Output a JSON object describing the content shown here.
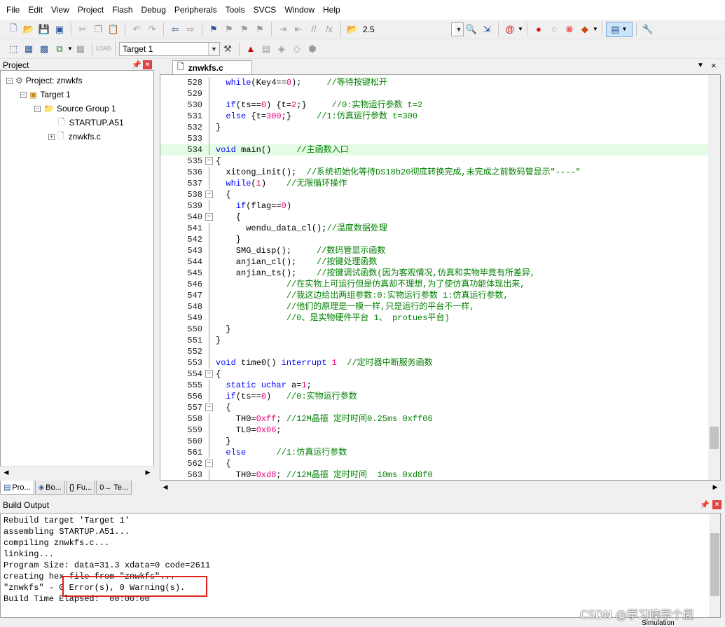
{
  "menu": [
    "File",
    "Edit",
    "View",
    "Project",
    "Flash",
    "Debug",
    "Peripherals",
    "Tools",
    "SVCS",
    "Window",
    "Help"
  ],
  "toolbar": {
    "opt_value": "2.5",
    "target_value": "Target 1"
  },
  "project_panel": {
    "title": "Project",
    "tree": {
      "project": "Project: znwkfs",
      "target": "Target 1",
      "group": "Source Group 1",
      "files": [
        "STARTUP.A51",
        "znwkfs.c"
      ]
    },
    "tabs": [
      "Pro...",
      "Bo...",
      "{} Fu...",
      "0→ Te..."
    ]
  },
  "editor": {
    "tab": "znwkfs.c",
    "lines": [
      {
        "n": "528",
        "code": "  while(Key4==0);     //等待按键松开"
      },
      {
        "n": "529",
        "code": ""
      },
      {
        "n": "530",
        "code": "  if(ts==0) {t=2;}     //0:实物运行参数 t=2"
      },
      {
        "n": "531",
        "code": "  else {t=300;}     //1:仿真运行参数 t=300"
      },
      {
        "n": "532",
        "code": "}"
      },
      {
        "n": "533",
        "code": ""
      },
      {
        "n": "534",
        "code": "void main()     //主函数入口"
      },
      {
        "n": "535",
        "code": "{"
      },
      {
        "n": "536",
        "code": "  xitong_init();  //系统初始化等待DS18b20彻底转换完成,未完成之前数码管显示\"----\""
      },
      {
        "n": "537",
        "code": "  while(1)    //无限循环操作"
      },
      {
        "n": "538",
        "code": "  {"
      },
      {
        "n": "539",
        "code": "    if(flag==0)"
      },
      {
        "n": "540",
        "code": "    {"
      },
      {
        "n": "541",
        "code": "      wendu_data_cl();//温度数据处理"
      },
      {
        "n": "542",
        "code": "    }"
      },
      {
        "n": "543",
        "code": "    SMG_disp();     //数码管显示函数"
      },
      {
        "n": "544",
        "code": "    anjian_cl();    //按键处理函数"
      },
      {
        "n": "545",
        "code": "    anjian_ts();    //按键调试函数(因为客观情况,仿真和实物毕竟有所差异,"
      },
      {
        "n": "546",
        "code": "              //在实物上可运行但是仿真却不理想,为了使仿真功能体现出来,"
      },
      {
        "n": "547",
        "code": "              //我这边给出两组参数:0:实物运行参数 1:仿真运行参数,"
      },
      {
        "n": "548",
        "code": "              //他们的原理是一模一样,只是运行的平台不一样,"
      },
      {
        "n": "549",
        "code": "              //0、是实物硬件平台 1、 protues平台)"
      },
      {
        "n": "550",
        "code": "  }"
      },
      {
        "n": "551",
        "code": "}"
      },
      {
        "n": "552",
        "code": ""
      },
      {
        "n": "553",
        "code": "void time0() interrupt 1  //定时器中断服务函数"
      },
      {
        "n": "554",
        "code": "{"
      },
      {
        "n": "555",
        "code": "  static uchar a=1;"
      },
      {
        "n": "556",
        "code": "  if(ts==0)   //0:实物运行参数"
      },
      {
        "n": "557",
        "code": "  {"
      },
      {
        "n": "558",
        "code": "    TH0=0xff; //12M晶振 定时时间0.25ms 0xff06"
      },
      {
        "n": "559",
        "code": "    TL0=0x06;"
      },
      {
        "n": "560",
        "code": "  }"
      },
      {
        "n": "561",
        "code": "  else      //1:仿真运行参数"
      },
      {
        "n": "562",
        "code": "  {"
      },
      {
        "n": "563",
        "code": "    TH0=0xd8; //12M晶振 定时时间  10ms 0xd8f0"
      }
    ]
  },
  "build_output": {
    "title": "Build Output",
    "lines": [
      "Rebuild target 'Target 1'",
      "assembling STARTUP.A51...",
      "compiling znwkfs.c...",
      "linking...",
      "Program Size: data=31.3 xdata=0 code=2611",
      "creating hex file from \"znwkfs\"...",
      "\"znwkfs\" - 0 Error(s), 0 Warning(s).",
      "Build Time Elapsed:  00:00:00"
    ]
  },
  "status": {
    "mode": "Simulation"
  },
  "watermark": "CSDN @学习噢学个屁",
  "colors": {
    "keyword": "#0000ff",
    "comment": "#008000",
    "number": "#e6007e",
    "highlight_line": "#e4fbe4",
    "annotation_box": "#e0201c"
  }
}
